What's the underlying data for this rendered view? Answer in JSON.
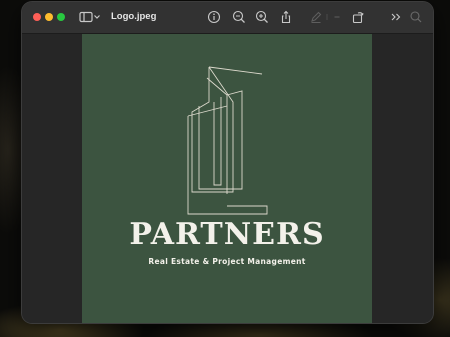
{
  "window": {
    "title": "Logo.jpeg",
    "toolbar_icons": [
      "sidebar-icon",
      "chevron-down-icon",
      "info-icon",
      "zoom-out-icon",
      "zoom-in-icon",
      "share-icon",
      "markup-pen-icon",
      "more-chevron-icon",
      "rotate-icon",
      "double-chevron-icon",
      "search-icon"
    ]
  },
  "image": {
    "brand_name": "PARTNERS",
    "tagline": "Real Estate & Project Management",
    "background_color": "#3c5440",
    "text_color": "#f3f1ea"
  }
}
